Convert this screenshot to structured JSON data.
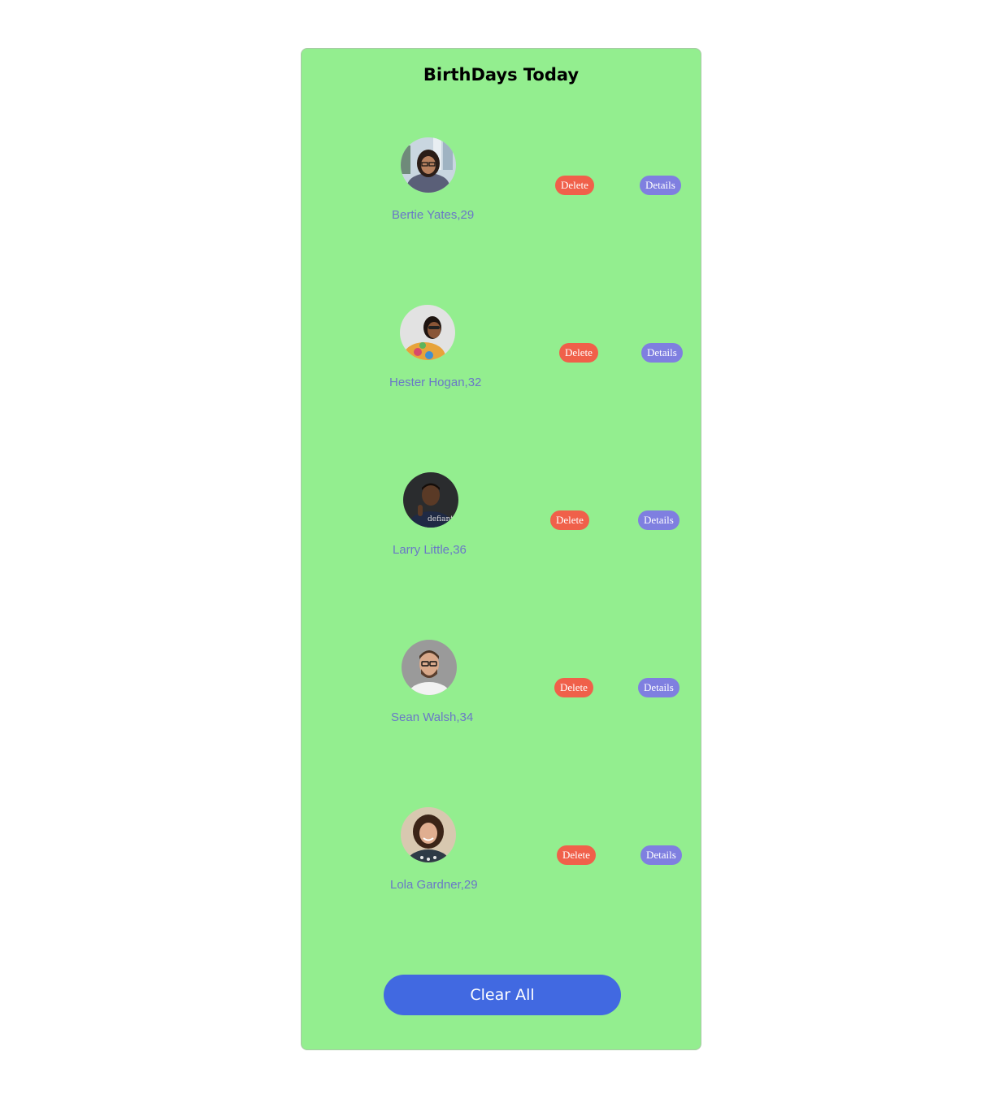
{
  "header": {
    "title": "BirthDays Today"
  },
  "people": [
    {
      "name": "Bertie Yates,29",
      "delete_label": "Delete",
      "details_label": "Details",
      "avatar_icon": "person-avatar-woman-glasses-city"
    },
    {
      "name": "Hester Hogan,32",
      "delete_label": "Delete",
      "details_label": "Details",
      "avatar_icon": "person-avatar-woman-sunglasses-floral"
    },
    {
      "name": "Larry Little,36",
      "delete_label": "Delete",
      "details_label": "Details",
      "avatar_icon": "person-avatar-man-dark"
    },
    {
      "name": "Sean Walsh,34",
      "delete_label": "Delete",
      "details_label": "Details",
      "avatar_icon": "person-avatar-man-glasses-beard"
    },
    {
      "name": "Lola Gardner,29",
      "delete_label": "Delete",
      "details_label": "Details",
      "avatar_icon": "person-avatar-woman-curly-hair"
    }
  ],
  "footer": {
    "clear_label": "Clear All"
  },
  "colors": {
    "card_background": "#93ee8f",
    "delete_button": "#f0604a",
    "details_button": "#7f7fe0",
    "clear_button": "#4169e1",
    "name_text": "#6a78c7"
  }
}
